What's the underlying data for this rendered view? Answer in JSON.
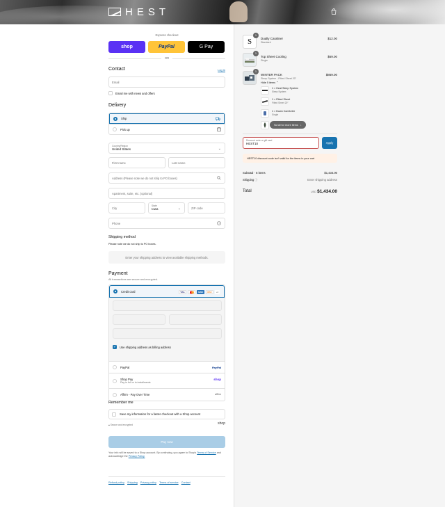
{
  "header": {
    "brand": "HEST",
    "cart_icon": "bag-icon"
  },
  "express": {
    "title": "Express checkout",
    "shop_label": "shop",
    "paypal_label": "PayPal",
    "gpay_label": "G Pay",
    "or_label": "OR"
  },
  "contact": {
    "heading": "Contact",
    "login_label": "Log in",
    "email_placeholder": "Email",
    "newsletter_label": "Email me with news and offers"
  },
  "delivery": {
    "heading": "Delivery",
    "options": [
      {
        "label": "Ship",
        "icon": "truck-icon",
        "selected": true
      },
      {
        "label": "Pick up",
        "icon": "store-icon",
        "selected": false
      }
    ],
    "country_label": "Country/Region",
    "country_value": "United States",
    "first_name_placeholder": "First name",
    "last_name_placeholder": "Last name",
    "address_placeholder": "Address (Please note we do not ship to PO boxes)",
    "apartment_placeholder": "Apartment, suite, etc. (optional)",
    "city_placeholder": "City",
    "state_label": "State",
    "state_value": "Iowa",
    "zip_placeholder": "ZIP code",
    "phone_placeholder": "Phone"
  },
  "shipping_method": {
    "heading": "Shipping method",
    "note": "Please note we do not ship to PO boxes.",
    "info": "Enter your shipping address to view available shipping methods."
  },
  "payment": {
    "heading": "Payment",
    "subtitle": "All transactions are secure and encrypted.",
    "credit_card_label": "Credit card",
    "cards": [
      "VISA",
      "MC",
      "AMEX",
      "DISC",
      "+4"
    ],
    "billing_label": "Use shipping address as billing address",
    "methods": [
      {
        "label": "PayPal",
        "sub": "",
        "logo": "PayPal"
      },
      {
        "label": "Shop Pay",
        "sub": "Pay in full or in installments",
        "logo": "shop"
      },
      {
        "label": "Affirm - Pay Over Time",
        "sub": "",
        "logo": "affirm"
      }
    ]
  },
  "remember": {
    "heading": "Remember me",
    "save_label": "Save my information for a faster checkout with a Shop account",
    "secure_label": "Secure and encrypted",
    "shop_logo": "shop"
  },
  "pay_now_label": "Pay now",
  "legal": {
    "text": "Your info will be saved to a Shop account. By continuing, you agree to Shop's",
    "terms": "Terms of Service",
    "and": "and acknowledge the",
    "privacy": "Privacy Policy."
  },
  "footer_links": [
    "Refund policy",
    "Shipping",
    "Privacy policy",
    "Terms of service",
    "Contact"
  ],
  "cart": {
    "items": [
      {
        "qty": "1",
        "name": "Dually Caraliner",
        "variant": "Standard",
        "price": "$12.00"
      },
      {
        "qty": "1",
        "name": "Top Sheet Cooling",
        "variant": "Single",
        "price": "$69.00"
      },
      {
        "qty": "1",
        "name": "WINTER PACK",
        "variant": "Sleep System - Fitted Sheet 20\"",
        "price": "$869.00"
      }
    ],
    "hide_label": "Hide 5 items",
    "sub_items": [
      {
        "name": "1 × Heat Sleep System",
        "variant": "Sleep System"
      },
      {
        "name": "1 × Fitted Sheet",
        "variant": "Fitted Sheet 20\""
      },
      {
        "name": "1 × Down Comforter",
        "variant": "Single"
      }
    ],
    "scroll_label": "Scroll for more items",
    "discount_label": "Discount code or gift card",
    "discount_value": "HEST10",
    "apply_label": "Apply",
    "error": "HEST10 discount code isn't valid for the items in your cart",
    "subtotal_label": "Subtotal · 5 items",
    "subtotal_value": "$1,434.00",
    "shipping_label": "Shipping",
    "shipping_value": "Enter shipping address",
    "total_label": "Total",
    "currency": "USD",
    "total_value": "$1,434.00"
  },
  "colors": {
    "accent": "#1773b0",
    "shop_purple": "#5a31f4",
    "paypal_yellow": "#ffc439",
    "error_bg": "#fff1e6"
  }
}
